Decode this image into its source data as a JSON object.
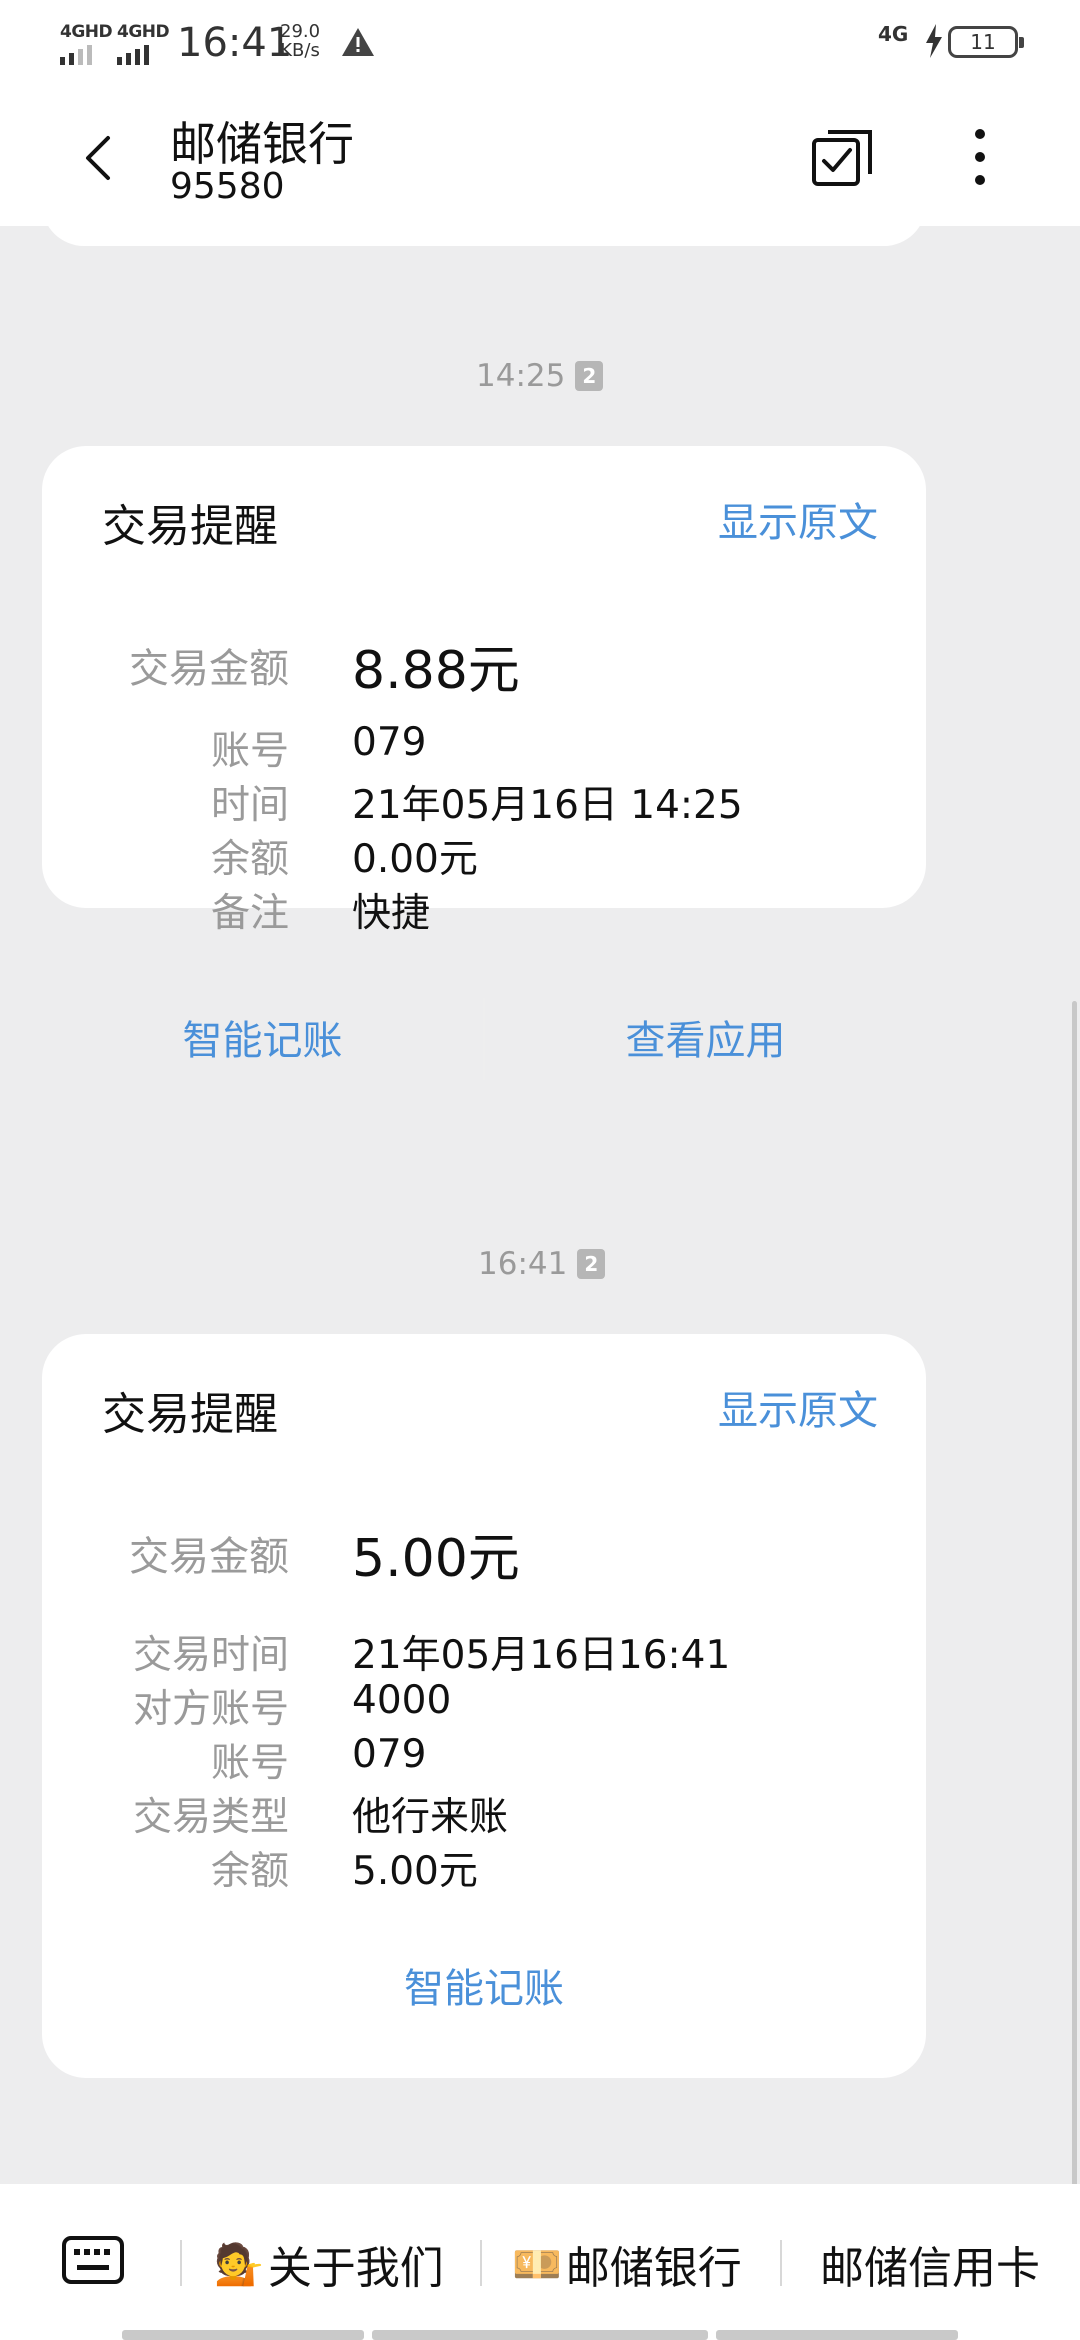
{
  "status_bar": {
    "sim1": "4GHD",
    "sim2": "4GHD",
    "time": "16:41",
    "speed_value": "29.0",
    "speed_unit": "KB/s",
    "network": "4G",
    "battery": "11"
  },
  "header": {
    "title": "邮储银行",
    "number": "95580"
  },
  "messages": [
    {
      "timestamp": "14:25",
      "sim_badge": "2",
      "title": "交易提醒",
      "show_original": "显示原文",
      "amount_label": "交易金额",
      "amount": "8.88元",
      "rows": [
        {
          "key": "账号",
          "value": "079"
        },
        {
          "key": "时间",
          "value": "21年05月16日 14:25"
        },
        {
          "key": "余额",
          "value": "0.00元"
        },
        {
          "key": "备注",
          "value": "快捷"
        }
      ],
      "actions": [
        "智能记账",
        "查看应用"
      ]
    },
    {
      "timestamp": "16:41",
      "sim_badge": "2",
      "title": "交易提醒",
      "show_original": "显示原文",
      "amount_label": "交易金额",
      "amount": "5.00元",
      "rows": [
        {
          "key": "交易时间",
          "value": "21年05月16日16:41"
        },
        {
          "key": "对方账号",
          "value": "4000"
        },
        {
          "key": "账号",
          "value": "079"
        },
        {
          "key": "交易类型",
          "value": "他行来账"
        },
        {
          "key": "余额",
          "value": "5.00元"
        }
      ],
      "actions": [
        "智能记账"
      ]
    }
  ],
  "bottom_menu": {
    "items": [
      {
        "emoji": "💁",
        "label": "关于我们"
      },
      {
        "emoji": "💴",
        "label": "邮储银行"
      },
      {
        "emoji": "",
        "label": "邮储信用卡"
      }
    ]
  },
  "colors": {
    "accent": "#4a90d9",
    "label_gray": "#9a9a9a",
    "background": "#ededee"
  }
}
